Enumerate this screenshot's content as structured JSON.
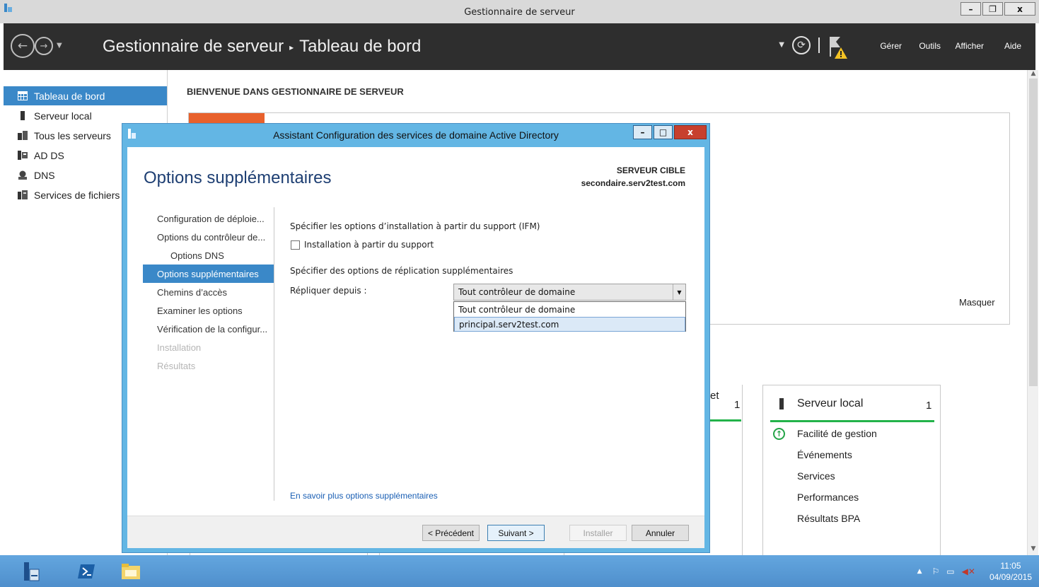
{
  "window": {
    "title": "Gestionnaire de serveur"
  },
  "header": {
    "breadcrumb_root": "Gestionnaire de serveur",
    "breadcrumb_sep": "▸",
    "breadcrumb_page": "Tableau de bord",
    "menu": [
      "Gérer",
      "Outils",
      "Afficher",
      "Aide"
    ]
  },
  "sidebar": {
    "items": [
      {
        "label": "Tableau de bord",
        "icon": "dashboard-icon"
      },
      {
        "label": "Serveur local",
        "icon": "server-icon"
      },
      {
        "label": "Tous les serveurs",
        "icon": "servers-icon"
      },
      {
        "label": "AD DS",
        "icon": "adds-icon"
      },
      {
        "label": "DNS",
        "icon": "dns-icon"
      },
      {
        "label": "Services de fichiers",
        "icon": "file-services-icon"
      }
    ]
  },
  "dashboard": {
    "welcome": "BIENVENUE DANS GESTIONNAIRE DE SERVEUR",
    "hide_label": "Masquer",
    "partial_tile": {
      "title_tail": "et",
      "count": "1"
    },
    "local_server_tile": {
      "title": "Serveur local",
      "count": "1",
      "rows": [
        "Facilité de gestion",
        "Événements",
        "Services",
        "Performances",
        "Résultats BPA"
      ]
    }
  },
  "dialog": {
    "title": "Assistant Configuration des services de domaine Active Directory",
    "heading": "Options supplémentaires",
    "target_label": "SERVEUR CIBLE",
    "target_value": "secondaire.serv2test.com",
    "steps": [
      {
        "label": "Configuration de déploie...",
        "state": "normal"
      },
      {
        "label": "Options du contrôleur de...",
        "state": "normal"
      },
      {
        "label": "Options DNS",
        "state": "sub"
      },
      {
        "label": "Options supplémentaires",
        "state": "active"
      },
      {
        "label": "Chemins d’accès",
        "state": "normal"
      },
      {
        "label": "Examiner les options",
        "state": "normal"
      },
      {
        "label": "Vérification de la configur...",
        "state": "normal"
      },
      {
        "label": "Installation",
        "state": "disabled"
      },
      {
        "label": "Résultats",
        "state": "disabled"
      }
    ],
    "ifm_heading": "Spécifier les options d’installation à partir du support (IFM)",
    "ifm_checkbox_label": "Installation à partir du support",
    "ifm_checked": false,
    "replication_heading": "Spécifier des options de réplication supplémentaires",
    "replicate_from_label": "Répliquer depuis :",
    "replicate_from_value": "Tout contrôleur de domaine",
    "replicate_options": [
      "Tout contrôleur de domaine",
      "principal.serv2test.com"
    ],
    "learn_more": "En savoir plus options supplémentaires",
    "buttons": {
      "previous": "< Précédent",
      "next": "Suivant >",
      "install": "Installer",
      "cancel": "Annuler"
    }
  },
  "taskbar": {
    "time": "11:05",
    "date": "04/09/2015"
  },
  "colors": {
    "accent": "#3a88c8",
    "dialog_frame": "#63b6e4",
    "header_bg": "#2e2e2e",
    "taskbar": "#5b9bd5",
    "status_ok": "#23b34a",
    "orange": "#e8612c"
  }
}
